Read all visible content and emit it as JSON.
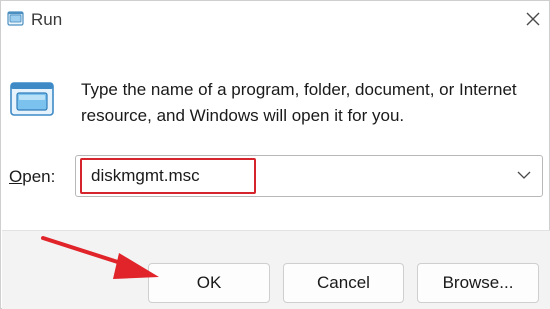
{
  "window": {
    "title": "Run",
    "app_icon": "run-icon",
    "close_icon": "close-icon"
  },
  "body": {
    "icon": "run-program-icon",
    "description": "Type the name of a program, folder, document, or Internet resource, and Windows will open it for you."
  },
  "open_field": {
    "label_accel": "O",
    "label_rest": "pen:",
    "value": "diskmgmt.msc",
    "dropdown_icon": "chevron-down-icon",
    "highlight_color": "#d6242d"
  },
  "buttons": {
    "ok": "OK",
    "cancel": "Cancel",
    "browse": "Browse..."
  },
  "annotation": {
    "arrow_icon": "red-arrow-icon",
    "color": "#e0242a"
  }
}
